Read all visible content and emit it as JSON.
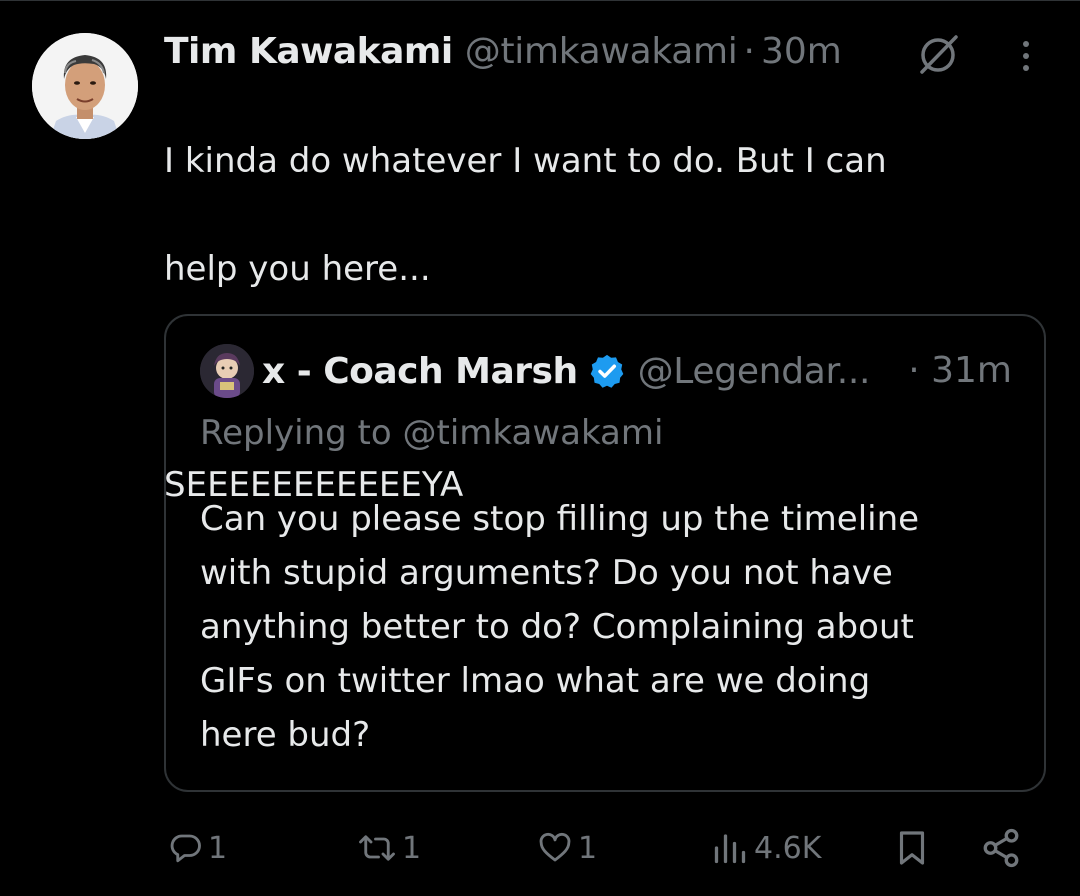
{
  "tweet": {
    "author": {
      "display_name": "Tim Kawakami",
      "handle": "@timkawakami"
    },
    "separator": "·",
    "timestamp": "30m",
    "text_lines": [
      "I kinda do whatever I want to do. But I can",
      "help you here...",
      "",
      "SEEEEEEEEEEEYA"
    ]
  },
  "quote": {
    "author": {
      "display_name": "x - Coach Marsh",
      "handle": "@Legendar...",
      "verified": true
    },
    "timestamp": "· 31m",
    "replying_to": "Replying to @timkawakami",
    "text_lines": [
      "Can you please stop filling up the timeline",
      "with stupid arguments? Do you not have",
      "anything better to do? Complaining about",
      "GIFs on twitter lmao what are we doing",
      "here bud?"
    ]
  },
  "actions": {
    "replies": "1",
    "reposts": "1",
    "likes": "1",
    "views": "4.6K"
  },
  "colors": {
    "background": "#000000",
    "text_primary": "#e7e9ea",
    "text_secondary": "#71767b",
    "border": "#2f3336",
    "verified_blue": "#1d9bf0"
  },
  "icons": [
    "grok-icon",
    "more-icon",
    "verified-icon",
    "reply-icon",
    "repost-icon",
    "like-icon",
    "views-icon",
    "bookmark-icon",
    "share-icon"
  ]
}
